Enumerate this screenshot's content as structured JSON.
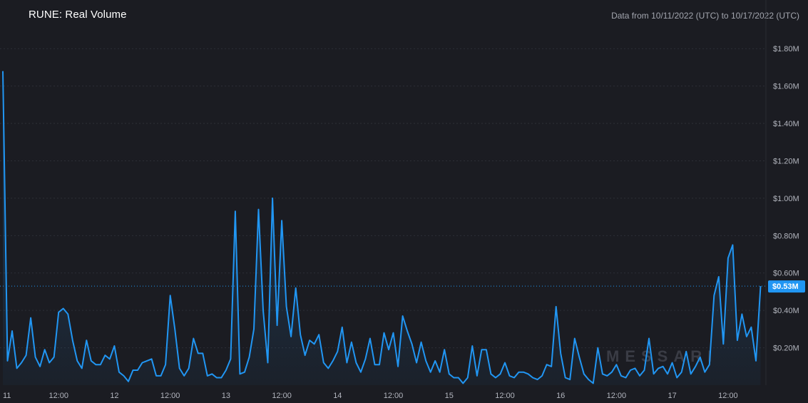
{
  "header": {
    "title": "RUNE: Real Volume",
    "range": "Data from 10/11/2022 (UTC) to 10/17/2022 (UTC)"
  },
  "colors": {
    "background": "#1b1c22",
    "line": "#2196f3",
    "current_label_bg": "#2196f3"
  },
  "watermark": "MESSARI",
  "chart_data": {
    "type": "area",
    "title": "RUNE: Real Volume",
    "xlabel": "",
    "ylabel": "",
    "x_ticks": [
      {
        "label": "11",
        "hour": 0
      },
      {
        "label": "12:00",
        "hour": 12
      },
      {
        "label": "12",
        "hour": 24
      },
      {
        "label": "12:00",
        "hour": 36
      },
      {
        "label": "13",
        "hour": 48
      },
      {
        "label": "12:00",
        "hour": 60
      },
      {
        "label": "14",
        "hour": 72
      },
      {
        "label": "12:00",
        "hour": 84
      },
      {
        "label": "15",
        "hour": 96
      },
      {
        "label": "12:00",
        "hour": 108
      },
      {
        "label": "16",
        "hour": 120
      },
      {
        "label": "12:00",
        "hour": 132
      },
      {
        "label": "17",
        "hour": 144
      },
      {
        "label": "12:00",
        "hour": 156
      }
    ],
    "y_ticks": [
      "$0.20M",
      "$0.40M",
      "$0.60M",
      "$0.80M",
      "$1.00M",
      "$1.20M",
      "$1.40M",
      "$1.60M",
      "$1.80M"
    ],
    "ylim": [
      0,
      1.9
    ],
    "xlim": [
      0,
      164
    ],
    "unit": "USD millions",
    "current_value_label": "$0.53M",
    "current_value": 0.53,
    "series": [
      {
        "values": [
          1.68,
          0.13,
          0.29,
          0.09,
          0.12,
          0.16,
          0.36,
          0.15,
          0.1,
          0.19,
          0.12,
          0.15,
          0.39,
          0.41,
          0.38,
          0.24,
          0.13,
          0.09,
          0.24,
          0.13,
          0.11,
          0.11,
          0.16,
          0.14,
          0.21,
          0.07,
          0.05,
          0.02,
          0.08,
          0.08,
          0.12,
          0.13,
          0.14,
          0.05,
          0.05,
          0.11,
          0.48,
          0.3,
          0.09,
          0.05,
          0.09,
          0.25,
          0.17,
          0.17,
          0.05,
          0.06,
          0.04,
          0.04,
          0.08,
          0.14,
          0.93,
          0.06,
          0.07,
          0.15,
          0.3,
          0.94,
          0.4,
          0.12,
          1.0,
          0.32,
          0.88,
          0.42,
          0.26,
          0.52,
          0.27,
          0.16,
          0.24,
          0.22,
          0.27,
          0.12,
          0.09,
          0.13,
          0.18,
          0.31,
          0.12,
          0.23,
          0.12,
          0.07,
          0.14,
          0.25,
          0.11,
          0.11,
          0.28,
          0.19,
          0.28,
          0.1,
          0.37,
          0.29,
          0.22,
          0.12,
          0.23,
          0.13,
          0.07,
          0.13,
          0.07,
          0.19,
          0.06,
          0.04,
          0.04,
          0.01,
          0.04,
          0.21,
          0.05,
          0.19,
          0.19,
          0.06,
          0.04,
          0.06,
          0.12,
          0.05,
          0.04,
          0.07,
          0.07,
          0.06,
          0.04,
          0.03,
          0.05,
          0.11,
          0.1,
          0.42,
          0.17,
          0.04,
          0.03,
          0.25,
          0.15,
          0.06,
          0.03,
          0.01,
          0.2,
          0.06,
          0.05,
          0.07,
          0.11,
          0.05,
          0.04,
          0.08,
          0.09,
          0.05,
          0.08,
          0.25,
          0.06,
          0.09,
          0.1,
          0.06,
          0.12,
          0.04,
          0.07,
          0.18,
          0.06,
          0.1,
          0.15,
          0.07,
          0.11,
          0.48,
          0.58,
          0.22,
          0.68,
          0.75,
          0.24,
          0.38,
          0.26,
          0.31,
          0.13,
          0.53
        ]
      }
    ]
  }
}
